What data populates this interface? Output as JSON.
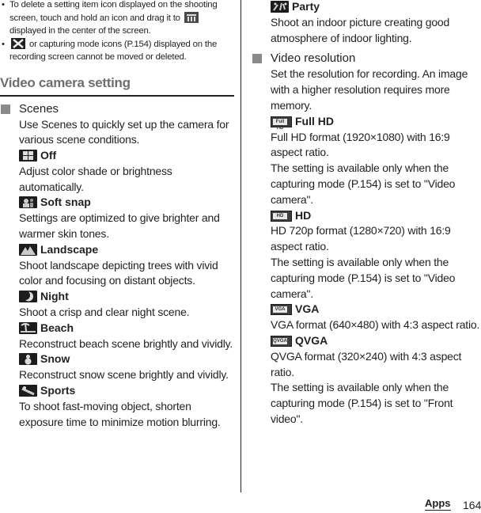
{
  "notes": [
    {
      "bullet": "•",
      "before_icon": "To delete a setting item icon displayed on the shooting screen, touch and hold an icon and drag it to",
      "icon": "trash-icon",
      "after_icon": "displayed in the center of the screen."
    },
    {
      "bullet": "•",
      "icon": "tools-icon",
      "after_icon": "or capturing mode icons (P.154) displayed on the recording screen cannot be moved or deleted."
    }
  ],
  "section_title": "Video camera setting",
  "scenes": {
    "heading": "Scenes",
    "description": "Use Scenes to quickly set up the camera for various scene conditions.",
    "options": [
      {
        "icon": "grid-off-icon",
        "label": "Off",
        "description": "Adjust color shade or brightness automatically."
      },
      {
        "icon": "soft-snap-icon",
        "label": "Soft snap",
        "description": "Settings are optimized to give brighter and warmer skin tones."
      },
      {
        "icon": "landscape-icon",
        "label": "Landscape",
        "description": "Shoot landscape depicting trees with vivid color and focusing on distant objects."
      },
      {
        "icon": "night-moon-icon",
        "label": "Night",
        "description": "Shoot a crisp and clear night scene."
      },
      {
        "icon": "beach-palm-icon",
        "label": "Beach",
        "description": "Reconstruct beach scene brightly and vividly."
      },
      {
        "icon": "snowman-icon",
        "label": "Snow",
        "description": "Reconstruct snow scene brightly and vividly."
      },
      {
        "icon": "sports-icon",
        "label": "Sports",
        "description": "To shoot fast-moving object, shorten exposure time to minimize motion blurring."
      },
      {
        "icon": "party-icon",
        "label": "Party",
        "description": "Shoot an indoor picture creating good atmosphere of indoor lighting."
      }
    ]
  },
  "video_resolution": {
    "heading": "Video resolution",
    "description": "Set the resolution for recording. An image with a higher resolution requires more memory.",
    "options": [
      {
        "icon": "full-hd-icon",
        "icon_text": "Full HD",
        "label": "Full HD",
        "description": "Full HD format (1920×1080) with 16:9 aspect ratio.",
        "note": "The setting is available only when the capturing mode (P.154) is set to \"Video camera\"."
      },
      {
        "icon": "hd-icon",
        "icon_text": "HD",
        "label": "HD",
        "description": "HD 720p format (1280×720) with 16:9 aspect ratio.",
        "note": "The setting is available only when the capturing mode (P.154) is set to \"Video camera\"."
      },
      {
        "icon": "vga-icon",
        "icon_text": "VGA",
        "label": "VGA",
        "description": "VGA format (640×480) with 4:3 aspect ratio.",
        "note": ""
      },
      {
        "icon": "qvga-icon",
        "icon_text": "QVGA",
        "label": "QVGA",
        "description": "QVGA format (320×240) with 4:3 aspect ratio.",
        "note": "The setting is available only when the capturing mode (P.154) is set to \"Front video\"."
      }
    ]
  },
  "footer": {
    "section": "Apps",
    "page_number": "164"
  }
}
